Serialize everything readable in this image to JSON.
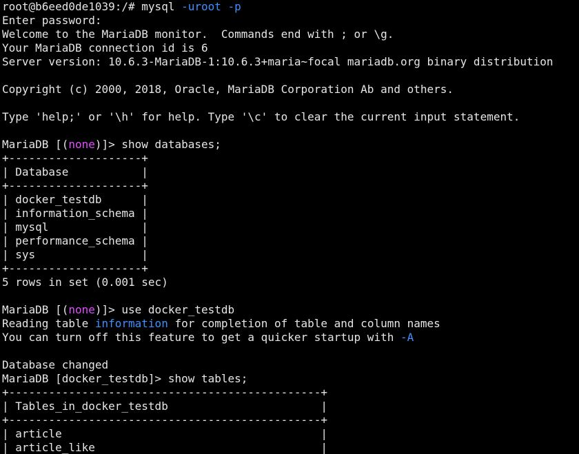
{
  "colors": {
    "background": "#000000",
    "foreground": "#e6e6e6",
    "highlight_blue": "#3f8fff",
    "highlight_magenta": "#e14dff"
  },
  "lines": [
    [
      {
        "t": "root@b6eed0de1039:/# mysql "
      },
      {
        "t": "-uroot -p",
        "c": "blue"
      }
    ],
    [
      {
        "t": "Enter password:"
      }
    ],
    [
      {
        "t": "Welcome to the MariaDB monitor.  Commands end with ; or \\g."
      }
    ],
    [
      {
        "t": "Your MariaDB connection id is 6"
      }
    ],
    [
      {
        "t": "Server version: 10.6.3-MariaDB-1:10.6.3+maria~focal mariadb.org binary distribution"
      }
    ],
    [
      {
        "t": ""
      }
    ],
    [
      {
        "t": "Copyright (c) 2000, 2018, Oracle, MariaDB Corporation Ab and others."
      }
    ],
    [
      {
        "t": ""
      }
    ],
    [
      {
        "t": "Type 'help;' or '\\h' for help. Type '\\c' to clear the current input statement."
      }
    ],
    [
      {
        "t": ""
      }
    ],
    [
      {
        "t": "MariaDB [("
      },
      {
        "t": "none",
        "c": "magenta"
      },
      {
        "t": ")]> show databases;"
      }
    ],
    [
      {
        "t": "+--------------------+"
      }
    ],
    [
      {
        "t": "| Database           |"
      }
    ],
    [
      {
        "t": "+--------------------+"
      }
    ],
    [
      {
        "t": "| docker_testdb      |"
      }
    ],
    [
      {
        "t": "| information_schema |"
      }
    ],
    [
      {
        "t": "| mysql              |"
      }
    ],
    [
      {
        "t": "| performance_schema |"
      }
    ],
    [
      {
        "t": "| sys                |"
      }
    ],
    [
      {
        "t": "+--------------------+"
      }
    ],
    [
      {
        "t": "5 rows in set (0.001 sec)"
      }
    ],
    [
      {
        "t": ""
      }
    ],
    [
      {
        "t": "MariaDB [("
      },
      {
        "t": "none",
        "c": "magenta"
      },
      {
        "t": ")]> use docker_testdb"
      }
    ],
    [
      {
        "t": "Reading table "
      },
      {
        "t": "information",
        "c": "blue"
      },
      {
        "t": " for completion of table and column names"
      }
    ],
    [
      {
        "t": "You can turn off this feature to get a quicker startup with "
      },
      {
        "t": "-A",
        "c": "blue"
      }
    ],
    [
      {
        "t": ""
      }
    ],
    [
      {
        "t": "Database changed"
      }
    ],
    [
      {
        "t": "MariaDB [docker_testdb]> show tables;"
      }
    ],
    [
      {
        "t": "+-----------------------------------------------+"
      }
    ],
    [
      {
        "t": "| Tables_in_docker_testdb                       |"
      }
    ],
    [
      {
        "t": "+-----------------------------------------------+"
      }
    ],
    [
      {
        "t": "| article                                       |"
      }
    ],
    [
      {
        "t": "| article_like                                  |"
      }
    ]
  ]
}
